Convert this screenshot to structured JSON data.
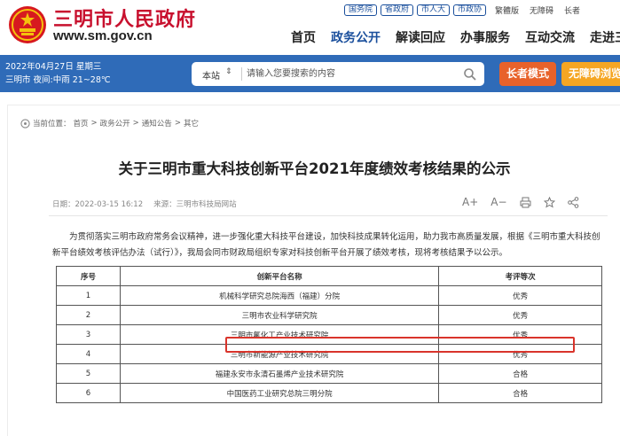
{
  "header": {
    "site_title": "三明市人民政府",
    "site_url": "www.sm.gov.cn",
    "top_links": [
      "国务院",
      "省政府",
      "市人大",
      "市政协"
    ],
    "top_tools": [
      "繁體版",
      "无障碍",
      "长者"
    ],
    "nav": [
      "首页",
      "政务公开",
      "解读回应",
      "办事服务",
      "互动交流",
      "走进三明"
    ],
    "active_nav": "政务公开",
    "brand_color": "#c8102e",
    "link_color": "#1a4f9c"
  },
  "bar": {
    "date_line": "2022年04月27日 星期三",
    "weather_line": "三明市 夜间:中雨 21~28℃",
    "search_scope": "本站",
    "search_placeholder": "请输入您要搜索的内容",
    "elder_mode_label": "长者模式",
    "accessibility_label": "无障碍浏览",
    "bar_color": "#2f6bb8"
  },
  "breadcrumb": {
    "prefix": "当前位置：",
    "items": [
      "首页",
      "政务公开",
      "通知公告",
      "其它"
    ],
    "separator": ">"
  },
  "article": {
    "title": "关于三明市重大科技创新平台2021年度绩效考核结果的公示",
    "date": "日期：2022-03-15 16:12",
    "source": "来源：三明市科技局网站",
    "tools": [
      "A+",
      "A−",
      "print",
      "star",
      "share"
    ],
    "intro": "为贯彻落实三明市政府常务会议精神，进一步强化重大科技平台建设，加快科技成果转化运用，助力我市高质量发展，根据《三明市重大科技创新平台绩效考核评估办法（试行）》，我局会同市财政局组织专家对科技创新平台开展了绩效考核，现将考核结果予以公示。"
  },
  "table": {
    "headers": [
      "序号",
      "创新平台名称",
      "考评等次"
    ],
    "rows": [
      [
        "1",
        "机械科学研究总院海西（福建）分院",
        "优秀"
      ],
      [
        "2",
        "三明市农业科学研究院",
        "优秀"
      ],
      [
        "3",
        "三明市氟化工产业技术研究院",
        "优秀"
      ],
      [
        "4",
        "三明市新能源产业技术研究院",
        "优秀"
      ],
      [
        "5",
        "福建永安市永清石墨烯产业技术研究院",
        "合格"
      ],
      [
        "6",
        "中国医药工业研究总院三明分院",
        "合格"
      ]
    ],
    "highlighted_row": 3,
    "highlight_color": "#d9342b"
  }
}
